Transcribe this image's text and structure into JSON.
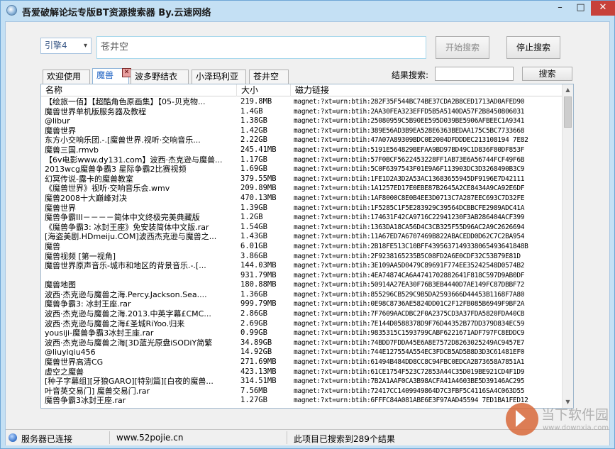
{
  "window": {
    "title": "吾爱破解论坛专版BT资源搜索器 By.云速网络"
  },
  "search": {
    "engine": "引擎4",
    "keyword": "苍井空",
    "start_label": "开始搜索",
    "stop_label": "停止搜索"
  },
  "tabs": [
    {
      "label": "欢迎使用"
    },
    {
      "label": "魔兽"
    },
    {
      "label": "波多野结衣"
    },
    {
      "label": "小泽玛利亚"
    },
    {
      "label": "苍井空"
    }
  ],
  "filter": {
    "label": "结果搜索:",
    "button": "搜索"
  },
  "table": {
    "columns": {
      "name": "名称",
      "size": "大小",
      "magnet": "磁力链接"
    },
    "rows": [
      {
        "name": "【绘旅一佰】【超酷角色原画集】【05-贝克物...",
        "size": "219.8MB",
        "magnet": "magnet:?xt=urn:btih:282F35F544BC74BE37CDA2B8CED1713AD0AFED90"
      },
      {
        "name": "魔兽世界单机版服务器及教程",
        "size": "1.4GB",
        "magnet": "magnet:?xt=urn:btih:2AA30FEA323EFFD5B5A5140DA57F2B8450806031"
      },
      {
        "name": "@libur",
        "size": "1.38GB",
        "magnet": "magnet:?xt=urn:btih:25080959C5B90EE595D039BE5906AFBEEC1A9341"
      },
      {
        "name": "魔兽世界",
        "size": "1.42GB",
        "magnet": "magnet:?xt=urn:btih:389E56AD3B9EA528E6363BEDAA175C5BC7733668"
      },
      {
        "name": "东方小交响乐团.-.[魔兽世界.视听·交响音乐...",
        "size": "2.22GB",
        "magnet": "magnet:?xt=urn:btih:47A07A89309BDC0E2004DFDDDEC213108194 7E82"
      },
      {
        "name": "魔兽三国.rmvb",
        "size": "245.41MB",
        "magnet": "magnet:?xt=urn:btih:5191E564829BEFAA9BD97BD49C1D836F80DF853F"
      },
      {
        "name": "【6v电影www.dy131.com】波西·杰克逊与魔兽...",
        "size": "1.17GB",
        "magnet": "magnet:?xt=urn:btih:57F0BCF5622453228FF1AB73E6A56744FCF49F6B"
      },
      {
        "name": "2013wcg魔兽争霸3 星际争霸2比赛视频",
        "size": "1.69GB",
        "magnet": "magnet:?xt=urn:btih:5C0F6397543F01E9A6F113903DC3D3268490B3C9"
      },
      {
        "name": "幻冥传说-露卡的魔兽教室",
        "size": "379.55MB",
        "magnet": "magnet:?xt=urn:btih:1FE1D2A3D2A53AC13683655945DF9196E7D42111"
      },
      {
        "name": "《魔兽世界》视听·交响音乐会.wmv",
        "size": "209.89MB",
        "magnet": "magnet:?xt=urn:btih:1A1257ED17E0EBE87B2645A2CE8434A9CA92E6DF"
      },
      {
        "name": "魔兽2008十大巅峰对决",
        "size": "470.13MB",
        "magnet": "magnet:?xt=urn:btih:1AF8000C8E0B4EE3D0713C7A287EEC693C7D32FE"
      },
      {
        "name": "魔兽世界",
        "size": "1.39GB",
        "magnet": "magnet:?xt=urn:btih:1F5285C1F5E283929C39564DCBBCFE2989ADC41A"
      },
      {
        "name": "魔兽争霸III－－－－简体中文终极完美典藏版",
        "size": "1.2GB",
        "magnet": "magnet:?xt=urn:btih:174631F42CA9716C22941230F3AB286404ACF399"
      },
      {
        "name": "《魔兽争霸3: 冰封王座》免安装简体中文版.rar",
        "size": "1.54GB",
        "magnet": "magnet:?xt=urn:btih:1363DA18CA56D4C3CB325F55D96AC2A9C2626694"
      },
      {
        "name": "[海盗美剧.HDmeiju.COM]波西杰克逊与魔兽之...",
        "size": "1.43GB",
        "magnet": "magnet:?xt=urn:btih:11A67ED7A6707469B822ABACEDD0D62C7C2BA954"
      },
      {
        "name": "魔兽",
        "size": "6.01GB",
        "magnet": "magnet:?xt=urn:btih:2B18FE513C10BFF4395637149338065493641848B"
      },
      {
        "name": "魔兽视频 [第一视角]",
        "size": "3.86GB",
        "magnet": "magnet:?xt=urn:btih:2F9238165235B5C08FD2A6E0CDF32C53B79E81D"
      },
      {
        "name": "魔兽世界原声音乐-城市和地区的背景音乐.-.[...",
        "size": "144.03MB",
        "magnet": "magnet:?xt=urn:btih:3E109AA5D0479C89691F774EE35242548D0574B2"
      },
      {
        "name": "",
        "size": "931.79MB",
        "magnet": "magnet:?xt=urn:btih:4EA74874CA6A4741702882641F818C597D9AB0DF"
      },
      {
        "name": "魔兽地图",
        "size": "180.88MB",
        "magnet": "magnet:?xt=urn:btih:50914A27EA30F76B3EB4440D7AE149FC87DBBF72"
      },
      {
        "name": "波西·杰克逊与魔兽之海.Percy.Jackson.Sea....",
        "size": "1.36GB",
        "magnet": "magnet:?xt=urn:btih:855296CB529C9B5DA2593666D44453B1168F7A80"
      },
      {
        "name": "魔兽争霸3: 冰封王座.rar",
        "size": "999.79MB",
        "magnet": "magnet:?xt=urn:btih:0E98C8736AE5824DD01C2F12FB085B6949F9BF2A"
      },
      {
        "name": "波西·杰克逊与魔兽之海.2013.中英字幕£CMC...",
        "size": "2.86GB",
        "magnet": "magnet:?xt=urn:btih:7F7609AACDBC2F0A2375CD3A37FDA5820FDA40CB"
      },
      {
        "name": "波西·杰克逊与魔兽之海£圣城RiYoo.归来",
        "size": "2.69GB",
        "magnet": "magnet:?xt=urn:btih:7E144D0588378D9F76D44352B77DD379D834EC59"
      },
      {
        "name": "yousiji-魔兽争霸3冰封王座.rar",
        "size": "0.99GB",
        "magnet": "magnet:?xt=urn:btih:9835315C1593799CABF6221671ADF797FC8EDDC9"
      },
      {
        "name": "波西·杰克逊与魔兽之海[3D蓝光原盘iSODiY简繁",
        "size": "34.89GB",
        "magnet": "magnet:?xt=urn:btih:74BDD7FDDA45E6A8E7572D8263025249AC9457E7"
      },
      {
        "name": "@liuyiqiu456",
        "size": "14.92GB",
        "magnet": "magnet:?xt=urn:btih:744E127554A554EC3FDCB5AD5B8D3D3C61481EF0"
      },
      {
        "name": "魔兽世界高清CG",
        "size": "271.69MB",
        "magnet": "magnet:?xt=urn:btih:61494B484DD8CC8C94FBC0EDCA2B73658A7851A1"
      },
      {
        "name": "虚空之魔兽",
        "size": "423.13MB",
        "magnet": "magnet:?xt=urn:btih:61CE1754F523C72853A44C35D019BE921CD4F1D9"
      },
      {
        "name": "[种子字幕组][牙狼GARO][特别篇][白夜的魔兽...",
        "size": "314.51MB",
        "magnet": "magnet:?xt=urn:btih:7B2A1AAF0CA3B98ACFA41A4603BE5D39146AC295"
      },
      {
        "name": "叶音英交易门] 魔兽交易门.rar",
        "size": "7.56MB",
        "magnet": "magnet:?xt=urn:btih:72417CC1409949864D7C3FBF5C4116SA4C063D55"
      },
      {
        "name": "魔兽争霸3冰封王座.rar",
        "size": "1.27GB",
        "magnet": "magnet:?xt=urn:btih:6FFFC84A081ABE6E3F97AAD45594 7ED1BA1FED12"
      }
    ]
  },
  "status": {
    "connection": "服务器已连接",
    "site": "www.52pojie.cn",
    "result_text": "此项目已搜索到289个结果"
  },
  "watermark": {
    "name": "当下软件园",
    "url": "www.downxia.com"
  },
  "icons": {
    "app": "bt-search-app-icon",
    "minimize": "minimize-icon",
    "maximize": "maximize-icon",
    "close": "close-icon",
    "tab_close": "tab-close-icon",
    "status": "status-globe-icon"
  },
  "colors": {
    "title_bar": "#c4e0f4",
    "active_tab_text": "#1a5fc2",
    "close_button": "#c7413a"
  }
}
